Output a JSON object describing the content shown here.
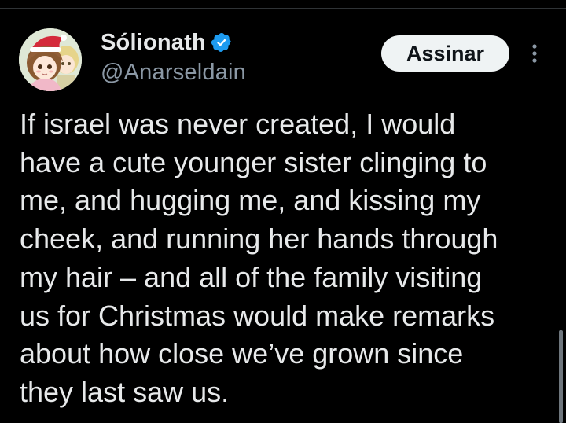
{
  "author": {
    "display_name": "Sólionath",
    "handle": "@Anarseldain",
    "verified": true,
    "avatar": "anime-girls-christmas-avatar"
  },
  "actions": {
    "subscribe_label": "Assinar",
    "more_icon": "more-vertical-icon"
  },
  "tweet": {
    "text": "If israel was never created, I would\nhave a cute younger sister clinging to\nme, and hugging me, and kissing my\ncheek, and running her hands through\nmy hair – and all of the family visiting\nus for Christmas would make remarks\nabout how close we’ve grown since\nthey last saw us."
  },
  "colors": {
    "background": "#000000",
    "text_primary": "#e7e9ea",
    "text_secondary": "#8b98a5",
    "verified_blue": "#1d9bf0",
    "button_bg": "#eff3f4",
    "button_text": "#0f1419"
  }
}
